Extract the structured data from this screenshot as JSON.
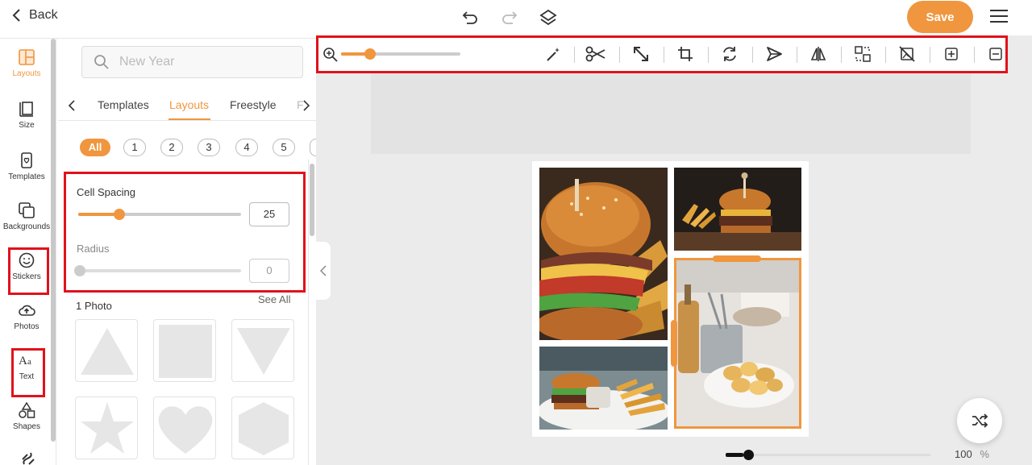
{
  "header": {
    "back_label": "Back",
    "save_label": "Save"
  },
  "rail": {
    "items": [
      {
        "label": "Layouts",
        "icon": "layouts-icon",
        "active": true
      },
      {
        "label": "Size",
        "icon": "size-icon"
      },
      {
        "label": "Templates",
        "icon": "templates-icon"
      },
      {
        "label": "Backgrounds",
        "icon": "backgrounds-icon"
      },
      {
        "label": "Stickers",
        "icon": "stickers-icon"
      },
      {
        "label": "Photos",
        "icon": "photos-icon"
      },
      {
        "label": "Text",
        "icon": "text-icon"
      },
      {
        "label": "Shapes",
        "icon": "shapes-icon"
      }
    ]
  },
  "panel": {
    "search_placeholder": "New Year",
    "tabs": [
      "Templates",
      "Layouts",
      "Freestyle",
      "F"
    ],
    "active_tab": "Layouts",
    "filters": [
      "All",
      "1",
      "2",
      "3",
      "4",
      "5"
    ],
    "cell_spacing": {
      "label": "Cell Spacing",
      "value": "25",
      "fraction": 0.25
    },
    "radius": {
      "label": "Radius",
      "value": "0",
      "fraction": 0
    },
    "section_title": "1 Photo",
    "see_all": "See All",
    "shapes": [
      "triangle",
      "square",
      "inverted-triangle",
      "star",
      "heart",
      "hexagon"
    ]
  },
  "toolbar": {
    "zoom_fraction": 0.24,
    "tools": [
      "magic-wand-icon",
      "scissors-icon",
      "resize-icon",
      "crop-icon",
      "rotate-icon",
      "send-icon",
      "flip-icon",
      "swap-icon",
      "no-image-icon",
      "zoom-in-icon",
      "zoom-out-icon"
    ]
  },
  "footer": {
    "zoom_value": "100",
    "zoom_unit": "%"
  },
  "colors": {
    "accent": "#f0963e",
    "highlight": "#e0121b"
  }
}
